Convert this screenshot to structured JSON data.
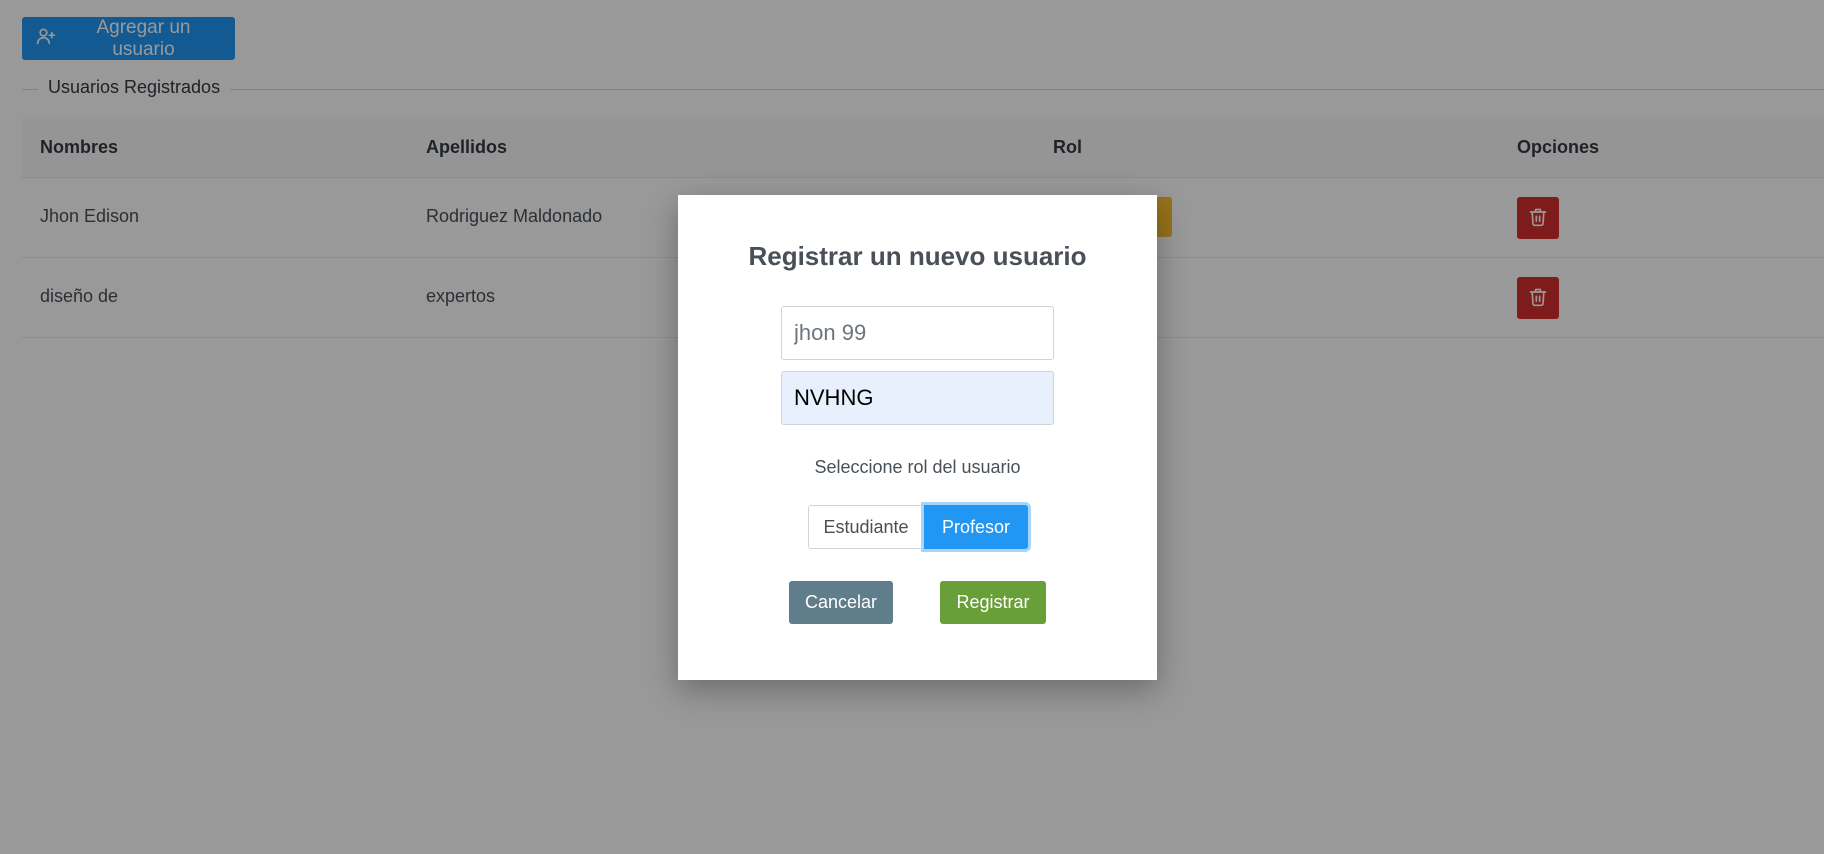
{
  "header": {
    "add_user_label": "Agregar un usuario",
    "add_user_icon": "user-plus-icon"
  },
  "section": {
    "legend": "Usuarios Registrados"
  },
  "table": {
    "columns": [
      "Nombres",
      "Apellidos",
      "Rol",
      "Opciones"
    ],
    "rows": [
      {
        "nombres": "Jhon Edison",
        "apellidos": "Rodriguez Maldonado"
      },
      {
        "nombres": "diseño de",
        "apellidos": "expertos"
      }
    ],
    "delete_icon": "trash-icon"
  },
  "colors": {
    "primary": "#2196f3",
    "danger": "#d32f2f",
    "warning": "#fbc02d",
    "success": "#689f38",
    "secondary": "#607d8b"
  },
  "modal": {
    "title": "Registrar un nuevo usuario",
    "username_value": "jhon 99",
    "password_value": "NVHNG",
    "role_prompt": "Seleccione rol del usuario",
    "role_options": [
      "Estudiante",
      "Profesor"
    ],
    "role_selected": "Profesor",
    "cancel_label": "Cancelar",
    "register_label": "Registrar"
  }
}
